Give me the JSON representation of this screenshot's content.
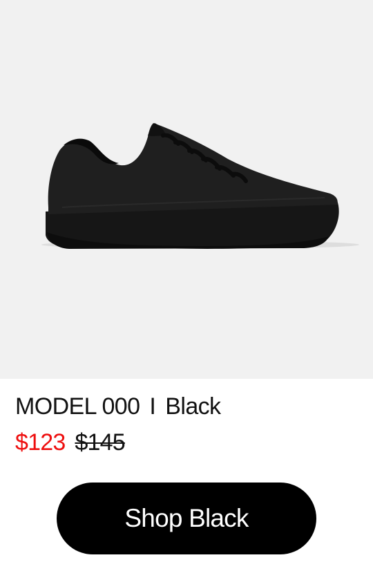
{
  "product": {
    "name": "MODEL 000",
    "separator": "I",
    "color": "Black",
    "sale_price": "$123",
    "original_price": "$145"
  },
  "cta": {
    "label": "Shop Black"
  },
  "image": {
    "subject": "shoe-image",
    "background": "#f1f1f1"
  },
  "colors": {
    "sale": "#ee0f0f",
    "button_bg": "#000000",
    "button_text": "#ffffff"
  }
}
